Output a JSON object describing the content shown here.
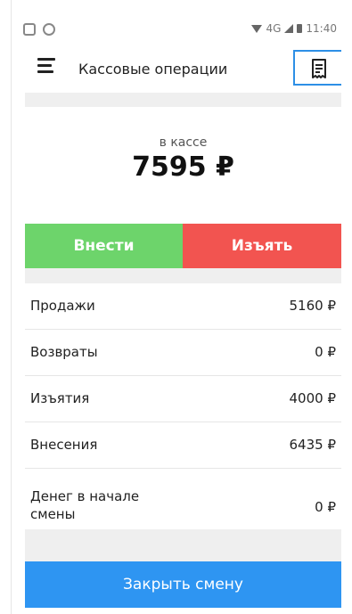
{
  "status_bar": {
    "network": "4G",
    "time": "11:40"
  },
  "app_bar": {
    "title": "Кассовые операции"
  },
  "balance": {
    "label": "в кассе",
    "value": "7595 ₽"
  },
  "actions": {
    "deposit_label": "Внести",
    "withdraw_label": "Изъять"
  },
  "summary": [
    {
      "label": "Продажи",
      "value": "5160 ₽"
    },
    {
      "label": "Возвраты",
      "value": "0 ₽"
    },
    {
      "label": "Изъятия",
      "value": "4000 ₽"
    },
    {
      "label": "Внесения",
      "value": "6435 ₽"
    },
    {
      "label": "Денег в начале смены",
      "value": "0 ₽"
    }
  ],
  "footer": {
    "close_shift_label": "Закрыть смену"
  },
  "colors": {
    "deposit": "#6dd46b",
    "withdraw": "#f25450",
    "primary": "#2e95f2"
  },
  "icons": {
    "menu": "hamburger-menu-icon",
    "receipt": "receipt-icon"
  }
}
